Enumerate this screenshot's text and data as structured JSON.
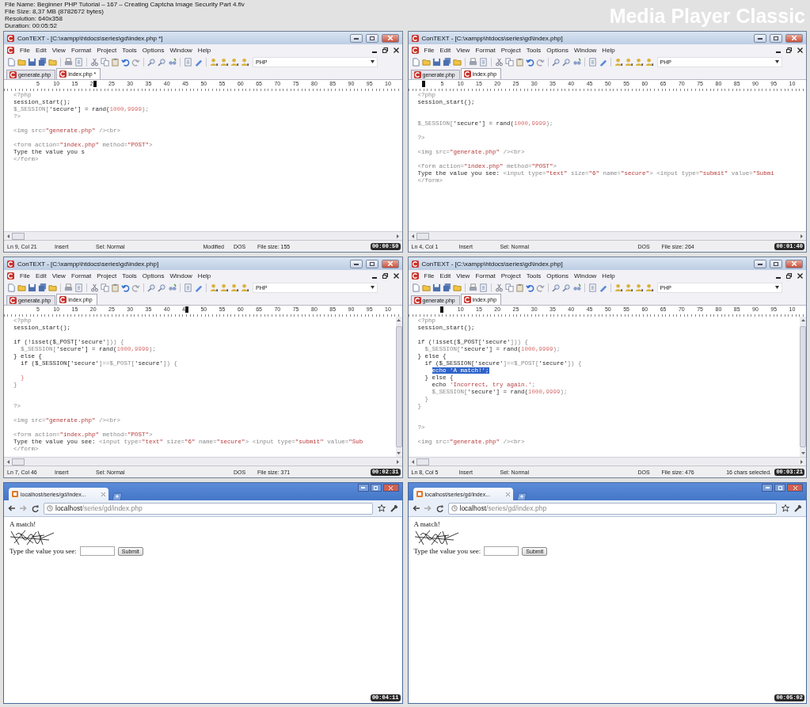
{
  "file_info": [
    "File Name: Beginner PHP Tutorial – 167 – Creating Captcha Image Security Part 4.flv",
    "File Size: 8,37 MB (8782672 bytes)",
    "Resolution: 640x358",
    "Duration: 00:05:52"
  ],
  "player_name": "Media Player Classic",
  "frames": [
    {
      "kind": "editor",
      "title": "ConTEXT - [C:\\xampp\\htdocs\\series\\gd\\index.php *]",
      "menu": [
        "File",
        "Edit",
        "View",
        "Format",
        "Project",
        "Tools",
        "Options",
        "Window",
        "Help"
      ],
      "language": "PHP",
      "tabs": [
        {
          "label": "generate.php",
          "selected": false
        },
        {
          "label": "index.php *",
          "selected": true
        }
      ],
      "ruler": [
        {
          "marker": false
        },
        {
          "text": "5",
          "marker": false
        },
        {
          "text": "10",
          "marker": false
        },
        {
          "text": "15",
          "marker": false
        },
        {
          "text": "2",
          "marker": true
        },
        {
          "text": "25",
          "marker": false
        },
        {
          "text": "30",
          "marker": false
        },
        {
          "text": "35",
          "marker": false
        },
        {
          "text": "40",
          "marker": false
        },
        {
          "text": "45",
          "marker": false
        },
        {
          "text": "50",
          "marker": false
        },
        {
          "text": "55",
          "marker": false
        },
        {
          "text": "60",
          "marker": false
        },
        {
          "text": "65",
          "marker": false
        },
        {
          "text": "70",
          "marker": false
        },
        {
          "text": "75",
          "marker": false
        },
        {
          "text": "80",
          "marker": false
        },
        {
          "text": "85",
          "marker": false
        },
        {
          "text": "90",
          "marker": false
        },
        {
          "text": "95",
          "marker": false
        },
        {
          "text": "10",
          "marker": false
        }
      ],
      "lines": [
        {
          "kind": "code",
          "segments": [
            {
              "text": "<?php",
              "kind": "muted"
            }
          ]
        },
        {
          "kind": "code",
          "segments": [
            {
              "text": "session_start();",
              "kind": "plain"
            }
          ]
        },
        {
          "kind": "code",
          "segments": [
            {
              "text": "$_SESSION[",
              "kind": "muted"
            },
            {
              "text": "'secure'",
              "kind": "plain"
            },
            {
              "text": "] = rand(",
              "kind": "plain"
            },
            {
              "text": "1000,9999",
              "kind": "number"
            },
            {
              "text": ");",
              "kind": "muted"
            }
          ]
        },
        {
          "kind": "code",
          "segments": [
            {
              "text": "?>",
              "kind": "muted"
            }
          ]
        },
        {
          "kind": "blank"
        },
        {
          "kind": "code",
          "segments": [
            {
              "text": "<img src=",
              "kind": "muted"
            },
            {
              "text": "\"generate.php\"",
              "kind": "string"
            },
            {
              "text": " /><br>",
              "kind": "muted"
            }
          ]
        },
        {
          "kind": "blank"
        },
        {
          "kind": "code",
          "segments": [
            {
              "text": "<form action=",
              "kind": "muted"
            },
            {
              "text": "\"index.php\"",
              "kind": "string"
            },
            {
              "text": " method=",
              "kind": "muted"
            },
            {
              "text": "\"POST\"",
              "kind": "string"
            },
            {
              "text": ">",
              "kind": "muted"
            }
          ]
        },
        {
          "kind": "code",
          "segments": [
            {
              "text": "Type the value you s",
              "kind": "plain"
            }
          ]
        },
        {
          "kind": "code",
          "segments": [
            {
              "text": "</form>",
              "kind": "muted"
            }
          ]
        }
      ],
      "vertical_scrollbar": false,
      "status": [
        {
          "kind": "position",
          "text": "Ln 9, Col 21"
        },
        {
          "kind": "mode",
          "text": "Insert"
        },
        {
          "kind": "sel",
          "text": "Sel: Normal"
        },
        {
          "kind": "modified",
          "text": "Modified"
        },
        {
          "kind": "eol",
          "text": "DOS"
        },
        {
          "kind": "size",
          "text": "File size: 155"
        }
      ],
      "timestamp": "00:00:50"
    },
    {
      "kind": "editor",
      "title": "ConTEXT - [C:\\xampp\\htdocs\\series\\gd\\index.php]",
      "menu": [
        "File",
        "Edit",
        "View",
        "Format",
        "Project",
        "Tools",
        "Options",
        "Window",
        "Help"
      ],
      "language": "PHP",
      "tabs": [
        {
          "label": "generate.php",
          "selected": false
        },
        {
          "label": "index.php",
          "selected": true
        }
      ],
      "ruler": [
        {
          "marker": true
        },
        {
          "text": "5",
          "marker": false
        },
        {
          "text": "10",
          "marker": false
        },
        {
          "text": "15",
          "marker": false
        },
        {
          "text": "20",
          "marker": false
        },
        {
          "text": "25",
          "marker": false
        },
        {
          "text": "30",
          "marker": false
        },
        {
          "text": "35",
          "marker": false
        },
        {
          "text": "40",
          "marker": false
        },
        {
          "text": "45",
          "marker": false
        },
        {
          "text": "50",
          "marker": false
        },
        {
          "text": "55",
          "marker": false
        },
        {
          "text": "60",
          "marker": false
        },
        {
          "text": "65",
          "marker": false
        },
        {
          "text": "70",
          "marker": false
        },
        {
          "text": "75",
          "marker": false
        },
        {
          "text": "80",
          "marker": false
        },
        {
          "text": "85",
          "marker": false
        },
        {
          "text": "90",
          "marker": false
        },
        {
          "text": "95",
          "marker": false
        },
        {
          "text": "10",
          "marker": false
        }
      ],
      "lines": [
        {
          "kind": "code",
          "segments": [
            {
              "text": "<?php",
              "kind": "muted"
            }
          ]
        },
        {
          "kind": "code",
          "segments": [
            {
              "text": "session_start();",
              "kind": "plain"
            }
          ]
        },
        {
          "kind": "blank"
        },
        {
          "kind": "blank"
        },
        {
          "kind": "code",
          "segments": [
            {
              "text": "$_SESSION[",
              "kind": "muted"
            },
            {
              "text": "'secure'",
              "kind": "plain"
            },
            {
              "text": "] = rand(",
              "kind": "plain"
            },
            {
              "text": "1000,9999",
              "kind": "number"
            },
            {
              "text": ");",
              "kind": "muted"
            }
          ]
        },
        {
          "kind": "blank"
        },
        {
          "kind": "code",
          "segments": [
            {
              "text": "?>",
              "kind": "muted"
            }
          ]
        },
        {
          "kind": "blank"
        },
        {
          "kind": "code",
          "segments": [
            {
              "text": "<img src=",
              "kind": "muted"
            },
            {
              "text": "\"generate.php\"",
              "kind": "string"
            },
            {
              "text": " /><br>",
              "kind": "muted"
            }
          ]
        },
        {
          "kind": "blank"
        },
        {
          "kind": "code",
          "segments": [
            {
              "text": "<form action=",
              "kind": "muted"
            },
            {
              "text": "\"index.php\"",
              "kind": "string"
            },
            {
              "text": " method=",
              "kind": "muted"
            },
            {
              "text": "\"POST\"",
              "kind": "string"
            },
            {
              "text": ">",
              "kind": "muted"
            }
          ]
        },
        {
          "kind": "code",
          "segments": [
            {
              "text": "Type the value you see: ",
              "kind": "plain"
            },
            {
              "text": "<input type=",
              "kind": "muted"
            },
            {
              "text": "\"text\"",
              "kind": "string"
            },
            {
              "text": " size=",
              "kind": "muted"
            },
            {
              "text": "\"6\"",
              "kind": "string"
            },
            {
              "text": " name=",
              "kind": "muted"
            },
            {
              "text": "\"secure\"",
              "kind": "string"
            },
            {
              "text": "> <input type=",
              "kind": "muted"
            },
            {
              "text": "\"submit\"",
              "kind": "string"
            },
            {
              "text": " value=",
              "kind": "muted"
            },
            {
              "text": "\"Submi",
              "kind": "string"
            }
          ]
        },
        {
          "kind": "code",
          "segments": [
            {
              "text": "</form>",
              "kind": "muted"
            }
          ]
        }
      ],
      "vertical_scrollbar": false,
      "status": [
        {
          "kind": "position",
          "text": "Ln 4, Col 1"
        },
        {
          "kind": "mode",
          "text": "Insert"
        },
        {
          "kind": "sel",
          "text": "Sel: Normal"
        },
        {
          "kind": "eol",
          "text": "DOS"
        },
        {
          "kind": "size",
          "text": "File size: 264"
        }
      ],
      "timestamp": "00:01:40"
    },
    {
      "kind": "editor",
      "title": "ConTEXT - [C:\\xampp\\htdocs\\series\\gd\\index.php]",
      "menu": [
        "File",
        "Edit",
        "View",
        "Format",
        "Project",
        "Tools",
        "Options",
        "Window",
        "Help"
      ],
      "language": "PHP",
      "tabs": [
        {
          "label": "generate.php",
          "selected": false
        },
        {
          "label": "index.php",
          "selected": true
        }
      ],
      "ruler": [
        {
          "marker": false
        },
        {
          "text": "5",
          "marker": false
        },
        {
          "text": "10",
          "marker": false
        },
        {
          "text": "15",
          "marker": false
        },
        {
          "text": "20",
          "marker": false
        },
        {
          "text": "25",
          "marker": false
        },
        {
          "text": "30",
          "marker": false
        },
        {
          "text": "35",
          "marker": false
        },
        {
          "text": "40",
          "marker": false
        },
        {
          "text": "4",
          "marker": true
        },
        {
          "text": "50",
          "marker": false
        },
        {
          "text": "55",
          "marker": false
        },
        {
          "text": "60",
          "marker": false
        },
        {
          "text": "65",
          "marker": false
        },
        {
          "text": "70",
          "marker": false
        },
        {
          "text": "75",
          "marker": false
        },
        {
          "text": "80",
          "marker": false
        },
        {
          "text": "85",
          "marker": false
        },
        {
          "text": "90",
          "marker": false
        },
        {
          "text": "95",
          "marker": false
        },
        {
          "text": "10",
          "marker": false
        }
      ],
      "lines": [
        {
          "kind": "code",
          "segments": [
            {
              "text": "<?php",
              "kind": "muted"
            }
          ]
        },
        {
          "kind": "code",
          "segments": [
            {
              "text": "session_start();",
              "kind": "plain"
            }
          ]
        },
        {
          "kind": "blank"
        },
        {
          "kind": "code",
          "segments": [
            {
              "text": "if (!isset($_POST[",
              "kind": "plain"
            },
            {
              "text": "'secure'",
              "kind": "plain"
            },
            {
              "text": "])) {",
              "kind": "muted"
            }
          ]
        },
        {
          "kind": "code",
          "segments": [
            {
              "text": "  $_SESSION[",
              "kind": "muted"
            },
            {
              "text": "'secure'",
              "kind": "plain"
            },
            {
              "text": "] = rand(",
              "kind": "plain"
            },
            {
              "text": "1000,9999",
              "kind": "number"
            },
            {
              "text": ");",
              "kind": "muted"
            }
          ]
        },
        {
          "kind": "code",
          "segments": [
            {
              "text": "} else {",
              "kind": "plain"
            }
          ]
        },
        {
          "kind": "code",
          "segments": [
            {
              "text": "  if ($_SESSION[",
              "kind": "plain"
            },
            {
              "text": "'secure'",
              "kind": "plain"
            },
            {
              "text": "]==$_POST[",
              "kind": "muted"
            },
            {
              "text": "'secure'",
              "kind": "plain"
            },
            {
              "text": "]) {",
              "kind": "muted"
            }
          ]
        },
        {
          "kind": "blank"
        },
        {
          "kind": "code",
          "segments": [
            {
              "text": "  }",
              "kind": "number"
            }
          ]
        },
        {
          "kind": "code",
          "segments": [
            {
              "text": "}",
              "kind": "muted"
            }
          ]
        },
        {
          "kind": "blank"
        },
        {
          "kind": "blank"
        },
        {
          "kind": "code",
          "segments": [
            {
              "text": "?>",
              "kind": "muted"
            }
          ]
        },
        {
          "kind": "blank"
        },
        {
          "kind": "code",
          "segments": [
            {
              "text": "<img src=",
              "kind": "muted"
            },
            {
              "text": "\"generate.php\"",
              "kind": "string"
            },
            {
              "text": " /><br>",
              "kind": "muted"
            }
          ]
        },
        {
          "kind": "blank"
        },
        {
          "kind": "code",
          "segments": [
            {
              "text": "<form action=",
              "kind": "muted"
            },
            {
              "text": "\"index.php\"",
              "kind": "string"
            },
            {
              "text": " method=",
              "kind": "muted"
            },
            {
              "text": "\"POST\"",
              "kind": "string"
            },
            {
              "text": ">",
              "kind": "muted"
            }
          ]
        },
        {
          "kind": "code",
          "segments": [
            {
              "text": "Type the value you see: ",
              "kind": "plain"
            },
            {
              "text": "<input type=",
              "kind": "muted"
            },
            {
              "text": "\"text\"",
              "kind": "string"
            },
            {
              "text": " size=",
              "kind": "muted"
            },
            {
              "text": "\"6\"",
              "kind": "string"
            },
            {
              "text": " name=",
              "kind": "muted"
            },
            {
              "text": "\"secure\"",
              "kind": "string"
            },
            {
              "text": "> <input type=",
              "kind": "muted"
            },
            {
              "text": "\"submit\"",
              "kind": "string"
            },
            {
              "text": " value=",
              "kind": "muted"
            },
            {
              "text": "\"Sub",
              "kind": "string"
            }
          ]
        },
        {
          "kind": "code",
          "segments": [
            {
              "text": "</form>",
              "kind": "muted"
            }
          ]
        }
      ],
      "vertical_scrollbar": true,
      "status": [
        {
          "kind": "position",
          "text": "Ln 7, Col 46"
        },
        {
          "kind": "mode",
          "text": "Insert"
        },
        {
          "kind": "sel",
          "text": "Sel: Normal"
        },
        {
          "kind": "eol",
          "text": "DOS"
        },
        {
          "kind": "size",
          "text": "File size: 371"
        }
      ],
      "timestamp": "00:02:31"
    },
    {
      "kind": "editor",
      "title": "ConTEXT - [C:\\xampp\\htdocs\\series\\gd\\index.php]",
      "menu": [
        "File",
        "Edit",
        "View",
        "Format",
        "Project",
        "Tools",
        "Options",
        "Window",
        "Help"
      ],
      "language": "PHP",
      "tabs": [
        {
          "label": "generate.php",
          "selected": false
        },
        {
          "label": "index.php",
          "selected": true
        }
      ],
      "ruler": [
        {
          "marker": false
        },
        {
          "marker": true
        },
        {
          "text": "10",
          "marker": false
        },
        {
          "text": "15",
          "marker": false
        },
        {
          "text": "20",
          "marker": false
        },
        {
          "text": "25",
          "marker": false
        },
        {
          "text": "30",
          "marker": false
        },
        {
          "text": "35",
          "marker": false
        },
        {
          "text": "40",
          "marker": false
        },
        {
          "text": "45",
          "marker": false
        },
        {
          "text": "50",
          "marker": false
        },
        {
          "text": "55",
          "marker": false
        },
        {
          "text": "60",
          "marker": false
        },
        {
          "text": "65",
          "marker": false
        },
        {
          "text": "70",
          "marker": false
        },
        {
          "text": "75",
          "marker": false
        },
        {
          "text": "80",
          "marker": false
        },
        {
          "text": "85",
          "marker": false
        },
        {
          "text": "90",
          "marker": false
        },
        {
          "text": "95",
          "marker": false
        },
        {
          "text": "10",
          "marker": false
        }
      ],
      "lines": [
        {
          "kind": "code",
          "segments": [
            {
              "text": "<?php",
              "kind": "muted"
            }
          ]
        },
        {
          "kind": "code",
          "segments": [
            {
              "text": "session_start();",
              "kind": "plain"
            }
          ]
        },
        {
          "kind": "blank"
        },
        {
          "kind": "code",
          "segments": [
            {
              "text": "if (!isset($_POST[",
              "kind": "plain"
            },
            {
              "text": "'secure'",
              "kind": "plain"
            },
            {
              "text": "])) {",
              "kind": "muted"
            }
          ]
        },
        {
          "kind": "code",
          "segments": [
            {
              "text": "  $_SESSION[",
              "kind": "muted"
            },
            {
              "text": "'secure'",
              "kind": "plain"
            },
            {
              "text": "] = rand(",
              "kind": "plain"
            },
            {
              "text": "1000,9999",
              "kind": "number"
            },
            {
              "text": ");",
              "kind": "muted"
            }
          ]
        },
        {
          "kind": "code",
          "segments": [
            {
              "text": "} else {",
              "kind": "plain"
            }
          ]
        },
        {
          "kind": "code",
          "segments": [
            {
              "text": "  if ($_SESSION[",
              "kind": "plain"
            },
            {
              "text": "'secure'",
              "kind": "plain"
            },
            {
              "text": "]==$_POST[",
              "kind": "muted"
            },
            {
              "text": "'secure'",
              "kind": "plain"
            },
            {
              "text": "]) {",
              "kind": "muted"
            }
          ]
        },
        {
          "kind": "code",
          "segments": [
            {
              "text": "    echo 'A match!';",
              "kind": "selected"
            }
          ]
        },
        {
          "kind": "code",
          "segments": [
            {
              "text": "  } else {",
              "kind": "plain"
            }
          ]
        },
        {
          "kind": "code",
          "segments": [
            {
              "text": "    echo ",
              "kind": "plain"
            },
            {
              "text": "'Incorrect, try again.'",
              "kind": "string"
            },
            {
              "text": ";",
              "kind": "muted"
            }
          ]
        },
        {
          "kind": "code",
          "segments": [
            {
              "text": "    $_SESSION[",
              "kind": "muted"
            },
            {
              "text": "'secure'",
              "kind": "plain"
            },
            {
              "text": "] = rand(",
              "kind": "plain"
            },
            {
              "text": "1000,9999",
              "kind": "number"
            },
            {
              "text": ");",
              "kind": "muted"
            }
          ]
        },
        {
          "kind": "code",
          "segments": [
            {
              "text": "  }",
              "kind": "muted"
            }
          ]
        },
        {
          "kind": "code",
          "segments": [
            {
              "text": "}",
              "kind": "muted"
            }
          ]
        },
        {
          "kind": "blank"
        },
        {
          "kind": "blank"
        },
        {
          "kind": "code",
          "segments": [
            {
              "text": "?>",
              "kind": "muted"
            }
          ]
        },
        {
          "kind": "blank"
        },
        {
          "kind": "code",
          "segments": [
            {
              "text": "<img src=",
              "kind": "muted"
            },
            {
              "text": "\"generate.php\"",
              "kind": "string"
            },
            {
              "text": " /><br>",
              "kind": "muted"
            }
          ]
        }
      ],
      "vertical_scrollbar": true,
      "status": [
        {
          "kind": "position",
          "text": "Ln 8, Col 5"
        },
        {
          "kind": "mode",
          "text": "Insert"
        },
        {
          "kind": "sel",
          "text": "Sel: Normal"
        },
        {
          "kind": "eol",
          "text": "DOS"
        },
        {
          "kind": "size",
          "text": "File size: 476"
        },
        {
          "kind": "selection",
          "text": "16 chars selected."
        }
      ],
      "timestamp": "00:03:21"
    },
    {
      "kind": "browser",
      "tab_title": "localhost/series/gd/index...",
      "url": {
        "host": "localhost",
        "path": "/series/gd/index.php"
      },
      "page": {
        "message": "A match!",
        "label": "Type the value you see:",
        "button": "Submit"
      },
      "timestamp": "00:04:11"
    },
    {
      "kind": "browser",
      "tab_title": "localhost/series/gd/index...",
      "url": {
        "host": "localhost",
        "path": "/series/gd/index.php"
      },
      "page": {
        "message": "A match!",
        "label": "Type the value you see:",
        "button": "Submit"
      },
      "timestamp": "00:05:02"
    }
  ]
}
